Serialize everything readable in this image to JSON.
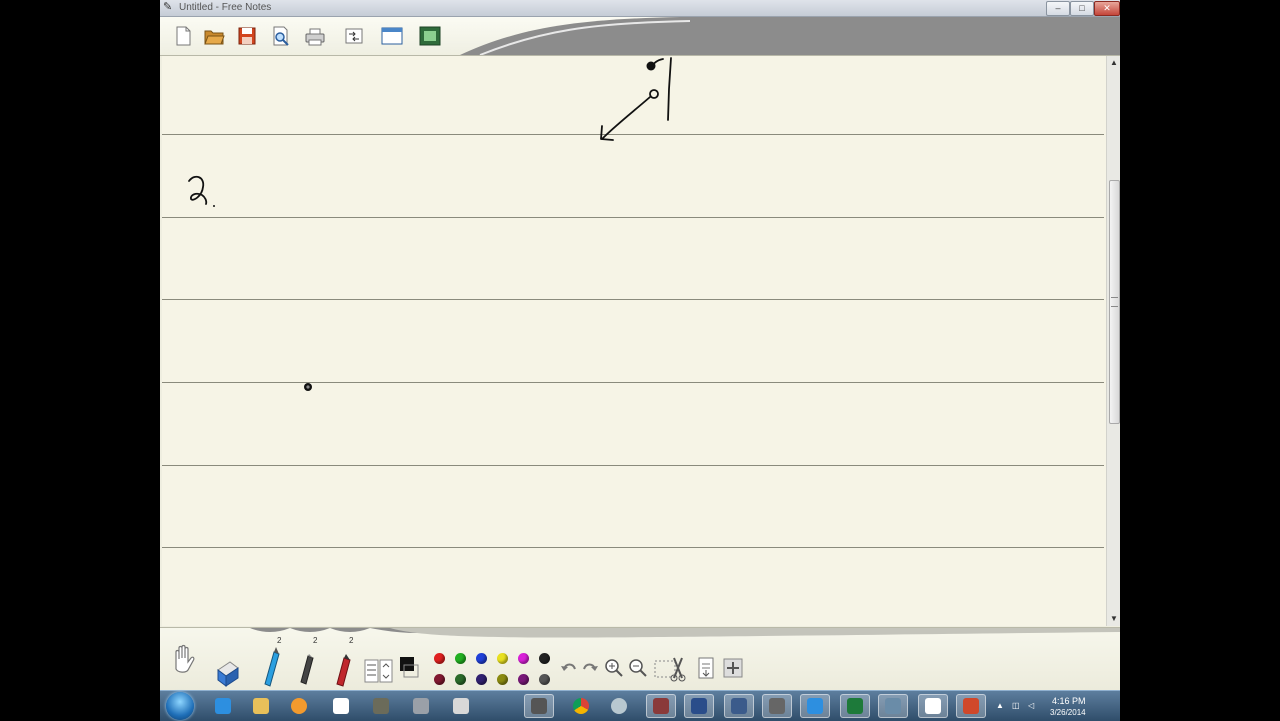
{
  "window": {
    "title": "Untitled - Free Notes",
    "controls": {
      "minimize": "–",
      "maximize": "□",
      "close": "✕"
    }
  },
  "toolbar": {
    "items": [
      {
        "name": "new-file-icon"
      },
      {
        "name": "open-folder-icon"
      },
      {
        "name": "save-icon"
      },
      {
        "name": "print-preview-icon"
      },
      {
        "name": "print-icon"
      },
      {
        "name": "import-export-icon"
      },
      {
        "name": "window-icon"
      },
      {
        "name": "screen-capture-icon"
      }
    ]
  },
  "bottombar": {
    "pen_sizes": [
      "2",
      "2",
      "2"
    ],
    "tools": [
      "hand-icon",
      "eraser-icon",
      "highlighter-icon",
      "pen-icon",
      "marker-icon",
      "text-lines-icon",
      "color-black-icon"
    ],
    "palette_top": [
      "#e02020",
      "#22b022",
      "#2040d8",
      "#e8e020",
      "#d820d8",
      "#222222"
    ],
    "palette_bottom": [
      "#801830",
      "#2a6a2a",
      "#302070",
      "#8a8a10",
      "#781878",
      "#555555"
    ]
  },
  "taskbar": {
    "time": "4:16 PM",
    "date": "3/26/2014"
  },
  "colors": {
    "page_background": "#f6f4e6",
    "rule_line": "#8a8a7c",
    "ink": "#111111"
  }
}
